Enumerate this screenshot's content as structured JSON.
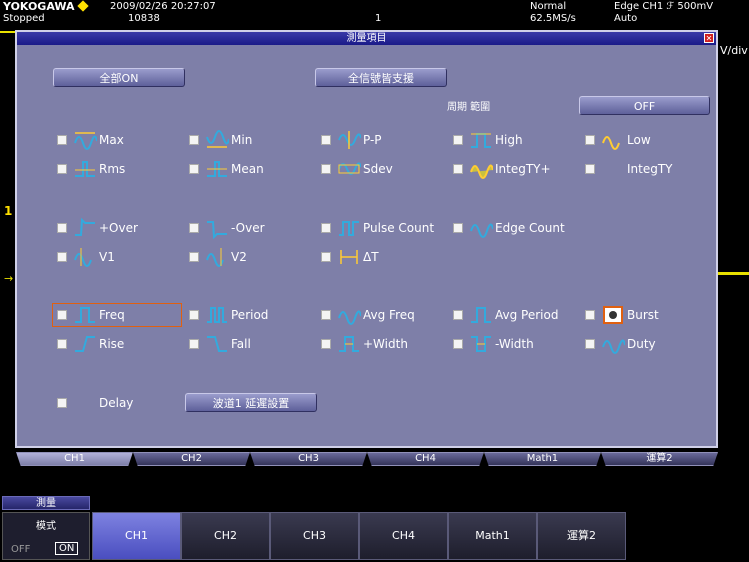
{
  "topbar": {
    "brand": "YOKOGAWA",
    "datetime": "2009/02/26 20:27:07",
    "status": "Stopped",
    "record": "10838",
    "marker": "1",
    "acq_mode": "Normal",
    "sample_rate": "62.5MS/s",
    "trigger": "Edge CH1 ℱ 500mV",
    "trigger_mode": "Auto"
  },
  "scope": {
    "vdiv": "V/div",
    "ch_marker": "1",
    "arrow_mark": "→"
  },
  "dialog": {
    "title": "測量項目",
    "all_on_button": "全部ON",
    "copy_button": "全信號皆支援",
    "period_label": "周期 範圍",
    "off_button": "OFF",
    "delay_button": "波道1 延遲設置",
    "items": {
      "max": "Max",
      "min": "Min",
      "pp": "P-P",
      "high": "High",
      "low": "Low",
      "rms": "Rms",
      "mean": "Mean",
      "sdev": "Sdev",
      "integ_plus": "IntegTY+",
      "integ": "IntegTY",
      "over_plus": "+Over",
      "over_minus": "-Over",
      "pulse_count": "Pulse Count",
      "edge_count": "Edge Count",
      "v1": "V1",
      "v2": "V2",
      "dt": "ΔT",
      "freq": "Freq",
      "period": "Period",
      "avg_freq": "Avg Freq",
      "avg_period": "Avg Period",
      "burst": "Burst",
      "rise": "Rise",
      "fall": "Fall",
      "width_plus": "+Width",
      "width_minus": "-Width",
      "duty": "Duty",
      "delay": "Delay"
    },
    "tabs": [
      "CH1",
      "CH2",
      "CH3",
      "CH4",
      "Math1",
      "運算2"
    ]
  },
  "bottom": {
    "menu_title": "測量",
    "mode_label": "模式",
    "off": "OFF",
    "on": "ON",
    "softkeys": [
      "CH1",
      "CH2",
      "CH3",
      "CH4",
      "Math1",
      "運算2"
    ]
  },
  "colors": {
    "dialog_bg": "#7e7fa8",
    "trace": "#e8e000",
    "selected_outline": "#e06010",
    "active_softkey": "#6e72d8"
  }
}
